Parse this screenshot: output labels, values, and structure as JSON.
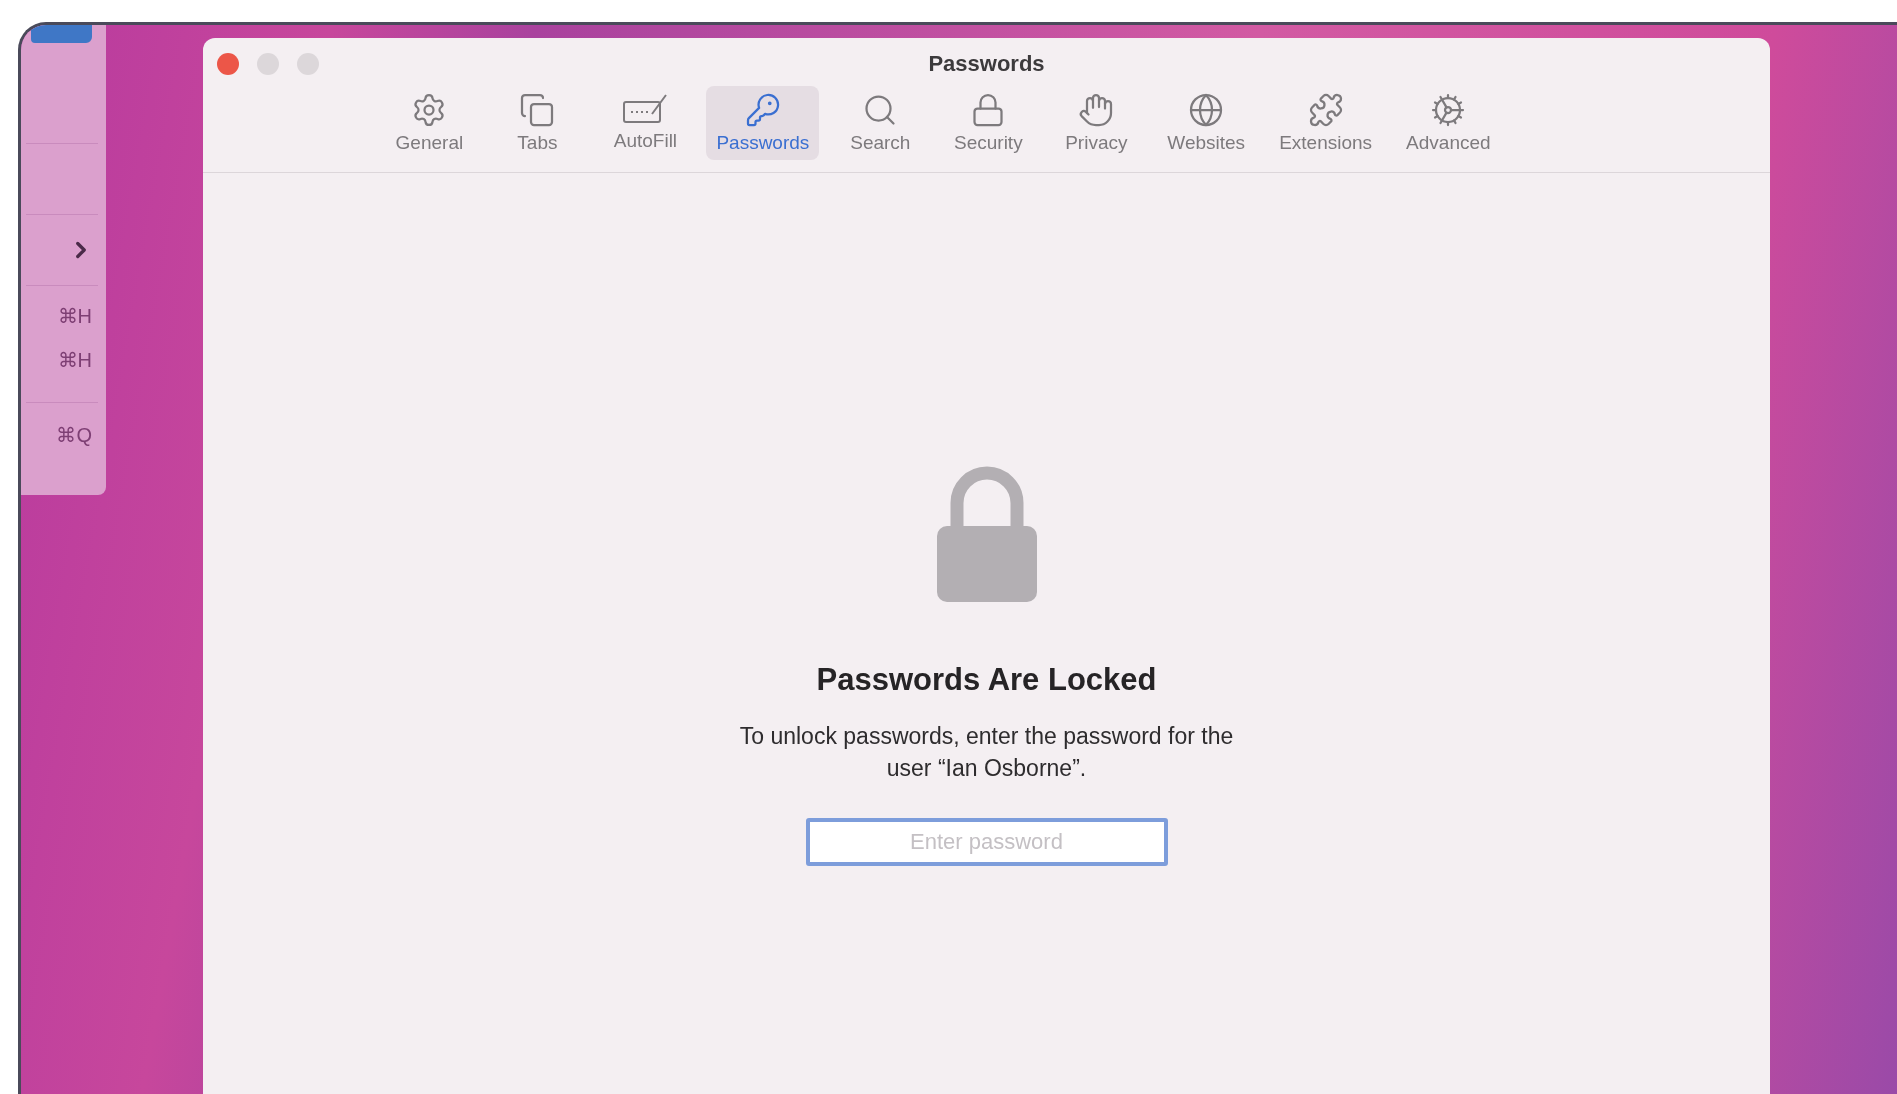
{
  "menu": {
    "shortcuts": [
      "⌘H",
      "⌘H",
      "⌘Q"
    ]
  },
  "window": {
    "title": "Passwords"
  },
  "tabs": [
    {
      "label": "General",
      "selected": false
    },
    {
      "label": "Tabs",
      "selected": false
    },
    {
      "label": "AutoFill",
      "selected": false
    },
    {
      "label": "Passwords",
      "selected": true
    },
    {
      "label": "Search",
      "selected": false
    },
    {
      "label": "Security",
      "selected": false
    },
    {
      "label": "Privacy",
      "selected": false
    },
    {
      "label": "Websites",
      "selected": false
    },
    {
      "label": "Extensions",
      "selected": false
    },
    {
      "label": "Advanced",
      "selected": false
    }
  ],
  "locked": {
    "heading": "Passwords Are Locked",
    "message": "To unlock passwords, enter the password for the user “Ian Osborne”.",
    "field": {
      "placeholder": "Enter password"
    }
  }
}
